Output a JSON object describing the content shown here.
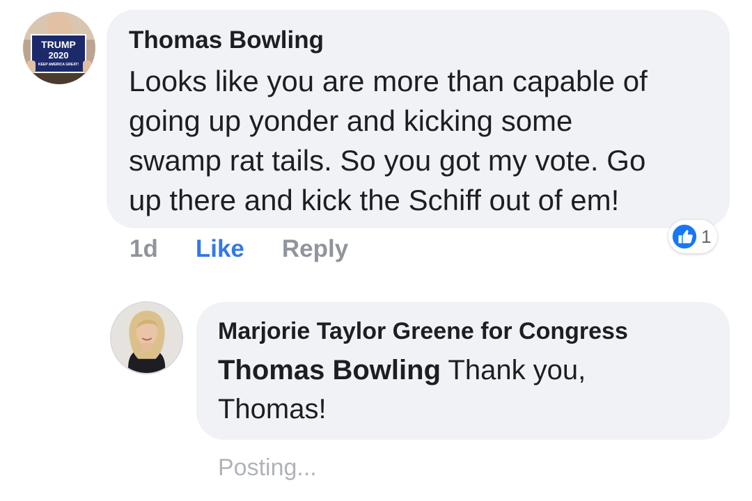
{
  "comment": {
    "author": "Thomas Bowling",
    "avatar_icon": "trump-2020-sign-avatar",
    "avatar_sign": {
      "line1": "TRUMP",
      "line2": "2020",
      "line3": "KEEP AMERICA GREAT!"
    },
    "text_lines": [
      "Looks like you are more than capable of",
      "going up yonder and kicking some",
      "swamp rat tails. So you got my vote. Go",
      "up there and kick the Schiff out of em!"
    ],
    "timestamp": "1d",
    "like_label": "Like",
    "reply_label": "Reply",
    "reaction": {
      "icon": "thumbs-up-icon",
      "count": "1",
      "color": "#1877f2"
    }
  },
  "reply": {
    "author": "Marjorie Taylor Greene for Congress",
    "avatar_icon": "woman-portrait-avatar",
    "mention": "Thomas Bowling",
    "text_line1": " Thank you,",
    "text_line2": "Thomas!",
    "status": "Posting..."
  },
  "colors": {
    "bubble": "#f0f2f5",
    "text": "#1c1e21",
    "muted": "#90949c",
    "accent": "#3578e5"
  }
}
